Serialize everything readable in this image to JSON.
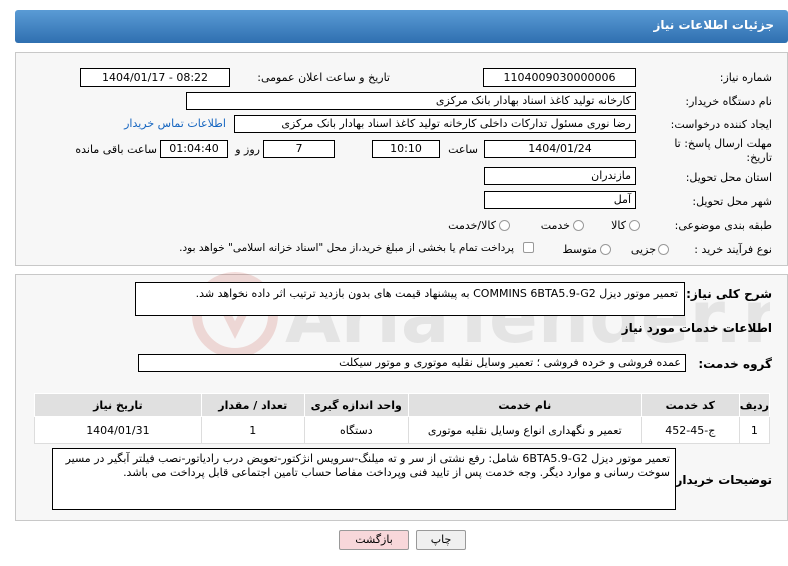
{
  "header": {
    "title": "جزئیات اطلاعات نیاز"
  },
  "form": {
    "need_number_label": "شماره نیاز:",
    "need_number": "1104009030000006",
    "announce_label": "تاریخ و ساعت اعلان عمومی:",
    "announce_value": "1404/01/17 - 08:22",
    "buyer_org_label": "نام دستگاه خریدار:",
    "buyer_org": "کارخانه تولید کاغذ اسناد بهادار بانک مرکزی",
    "creator_label": "ایجاد کننده درخواست:",
    "creator": "رضا نوری مسئول تدارکات داخلی کارخانه تولید کاغذ اسناد بهادار بانک مرکزی",
    "contact_link": "اطلاعات تماس خریدار",
    "deadline_label_1": "مهلت ارسال پاسخ: تا",
    "deadline_label_2": "تاریخ:",
    "deadline_date": "1404/01/24",
    "time_label": "ساعت",
    "deadline_time": "10:10",
    "days_value": "7",
    "days_label": "روز و",
    "remaining_time": "01:04:40",
    "remaining_label": "ساعت باقی مانده",
    "province_label": "استان محل تحویل:",
    "province": "مازندران",
    "city_label": "شهر محل تحویل:",
    "city": "آمل",
    "category_label": "طبقه بندی موضوعی:",
    "category_options": [
      "کالا",
      "خدمت",
      "کالا/خدمت"
    ],
    "process_label": "نوع فرآیند خرید :",
    "process_options": [
      "جزیی",
      "متوسط"
    ],
    "payment_note": "پرداخت تمام یا بخشی از مبلغ خرید،از محل \"اسناد خزانه اسلامی\" خواهد بود."
  },
  "details": {
    "general_desc_label": "شرح کلی نیاز:",
    "general_desc": "تعمیر موتور دیزل  COMMINS   6BTA5.9-G2   به پیشنهاد قیمت های بدون بازدید ترتیب اثر داده نخواهد شد.",
    "services_heading": "اطلاعات خدمات مورد نیاز",
    "service_group_label": "گروه خدمت:",
    "service_group": "عمده فروشی و خرده فروشی ؛ تعمیر وسایل نقلیه موتوری و موتور سیکلت",
    "table_headers": [
      "ردیف",
      "کد خدمت",
      "نام خدمت",
      "واحد اندازه گیری",
      "تعداد / مقدار",
      "تاریخ نیاز"
    ],
    "table_rows": [
      [
        "1",
        "ج-45-452",
        "تعمیر و نگهداری انواع وسایل نقلیه موتوری",
        "دستگاه",
        "1",
        "1404/01/31"
      ]
    ],
    "buyer_notes_label": "توضیحات خریدار:",
    "buyer_notes": "تعمیر موتور دیزل 6BTA5.9-G2 شامل: رفع نشتی از سر و ته میلنگ-سرویس انژکتور-تعویض درب رادیاتور-نصب فیلتر آبگیر در مسیر سوخت رسانی و موارد دیگر. وجه خدمت پس از تایید فنی وپرداخت مفاصا حساب تامین اجتماعی قابل پرداخت می باشد."
  },
  "buttons": {
    "print": "چاپ",
    "back": "بازگشت"
  },
  "watermark": {
    "text": "AriaTender.neT"
  },
  "colors": {
    "header_top": "#5a9bd5",
    "header_bottom": "#2f6fb0",
    "link": "#1565c0",
    "back_button": "#f8d7da"
  }
}
